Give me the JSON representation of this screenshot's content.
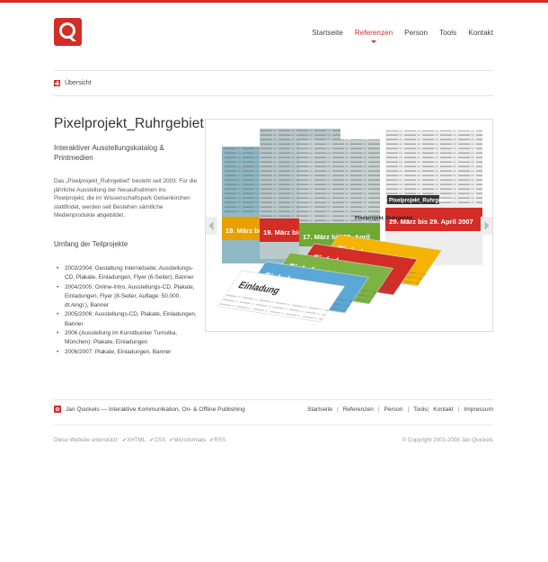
{
  "colors": {
    "brand": "#d22d26",
    "text": "#444444",
    "muted": "#9a9a9a"
  },
  "logo": {
    "icon": "q-logo-icon"
  },
  "nav": {
    "items": [
      "Startseite",
      "Referenzen",
      "Person",
      "Tools",
      "Kontakt"
    ],
    "active": "Referenzen"
  },
  "breadcrumb": {
    "label": "Übersicht",
    "icon": "grid-icon"
  },
  "project": {
    "title": "Pixelprojekt_Ruhrgebiet",
    "subtitle": "Interaktiver Ausstellungskatalog & Printmedien",
    "description": "Das „Pixelprojekt_Ruhrgebiet“ besteht seit 2003. Für die jährliche Ausstellung der Neuaufnahmen ins Pixelprojekt, die im Wissenschaftspark Gelsenkirchen stattfindet, werden seit Bestehen sämtliche Medienprodukte abgebildet.",
    "scope_heading": "Umfang der Teilprojekte",
    "items": [
      "2003/2004: Gestaltung Internetseite, Ausstellungs-CD, Plakate, Einladungen, Flyer (6-Seiter), Banner",
      "2004/2005: Online-Intro, Ausstellungs-CD, Plakate, Einladungen, Flyer (8-Seiter, Auflage: 50.000, dt./engl.), Banner",
      "2005/2006: Ausstellungs-CD, Plakate, Einladungen, Banner",
      "2006 (Ausstellung im Kunstbunker Tumulka, München): Plakate, Einladungen",
      "2006/2007: Plakate, Einladungen, Banner"
    ]
  },
  "gallery": {
    "prev_icon": "chevron-left-icon",
    "next_icon": "chevron-right-icon",
    "posters": [
      {
        "color": "#8fb8c4",
        "date": "19. März bis",
        "band": "#e8a000"
      },
      {
        "color": "#b9c9cc",
        "date": "19. März bis 30",
        "band": "#d22d26"
      },
      {
        "color": "#c9d3d2",
        "date": "17. März bis 23. April",
        "band": "#6fa832"
      },
      {
        "color": "#ededed",
        "date": "29. März bis 29. April 2007",
        "band": "#d22d26",
        "header": "Pixelprojekt_Ruhrgebiet"
      }
    ],
    "mini_header": "Pixelprojekt_Ruhrgebiet",
    "cards": [
      {
        "color": "#f4b400",
        "label": "Einladung"
      },
      {
        "color": "#d22d26",
        "label": "Einladung"
      },
      {
        "color": "#7cb342",
        "label": "Einladung"
      },
      {
        "color": "#5aa8d6",
        "label": "Einladung"
      },
      {
        "color": "#ffffff",
        "label": "Einladung"
      }
    ],
    "card_bottom": "29. März bis 29. April 2007"
  },
  "footer": {
    "tagline": "Jan Quickels — Interaktive Kommunikation, On- & Offline Publishing",
    "nav": [
      "Startseite",
      "Referenzen",
      "Person",
      "Tools",
      "Kontakt",
      "Impressum"
    ],
    "validators_label": "Diese Website unterstützt:",
    "validators": [
      "✔XHTML",
      "✔CSS",
      "✔Microformats",
      "✔RSS"
    ],
    "copyright": "© Copyright 2001-2008 Jan Quickels"
  }
}
